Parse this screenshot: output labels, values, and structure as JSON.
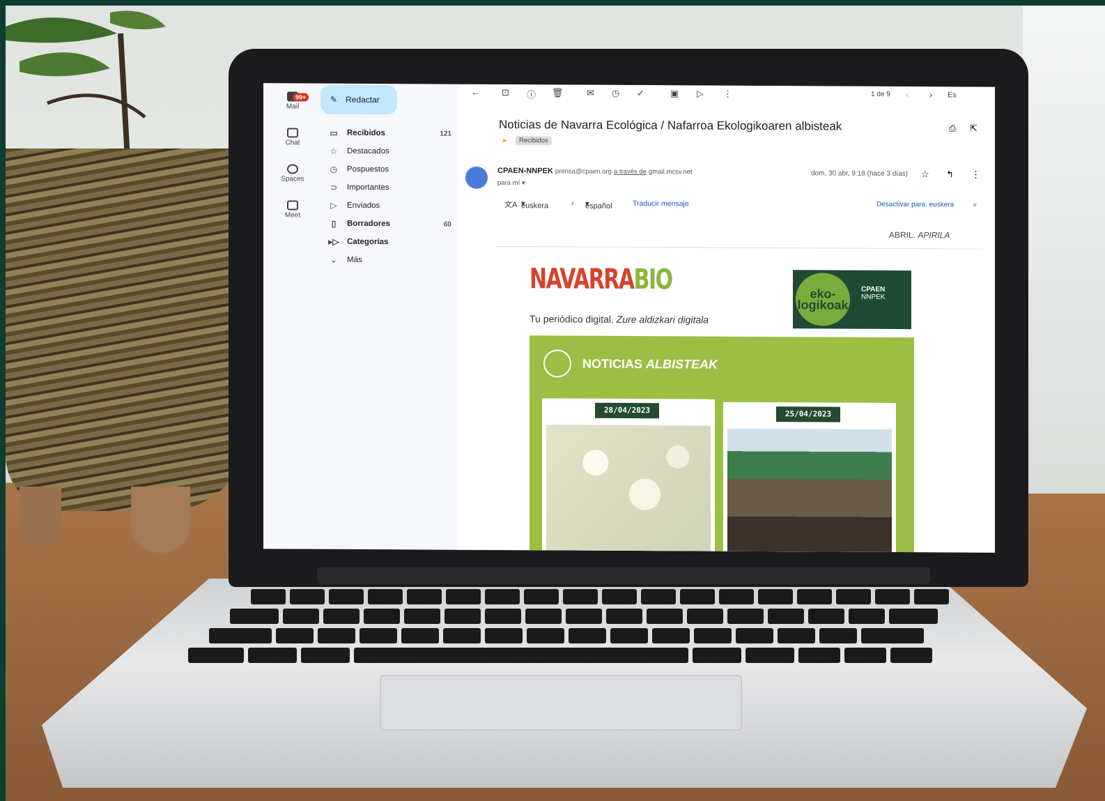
{
  "rail": {
    "mail_label": "Mail",
    "mail_badge": "99+",
    "chat_label": "Chat",
    "spaces_label": "Spaces",
    "meet_label": "Meet"
  },
  "compose": {
    "label": "Redactar"
  },
  "nav": {
    "items": [
      {
        "label": "Recibidos",
        "count": "121",
        "icon": "inbox-icon"
      },
      {
        "label": "Destacados",
        "count": "",
        "icon": "star-icon"
      },
      {
        "label": "Pospuestos",
        "count": "",
        "icon": "clock-icon"
      },
      {
        "label": "Importantes",
        "count": "",
        "icon": "important-icon"
      },
      {
        "label": "Enviados",
        "count": "",
        "icon": "send-icon"
      },
      {
        "label": "Borradores",
        "count": "60",
        "icon": "draft-icon"
      },
      {
        "label": "Categorías",
        "count": "",
        "icon": "label-icon"
      },
      {
        "label": "Más",
        "count": "",
        "icon": "chevron-down-icon"
      }
    ]
  },
  "toolbar": {
    "pager": "1 de 9",
    "lang": "Es"
  },
  "email": {
    "subject": "Noticias de Navarra Ecológica / Nafarroa Ekologikoaren albisteak",
    "label_chip": "Recibidos",
    "sender_name": "CPAEN-NNPEK",
    "sender_addr": "prensa@cpaen.org",
    "via_text": "a través de",
    "via_domain": "gmail.mcsv.net",
    "to_me": "para mí",
    "date": "dom, 30 abr, 9:18 (hace 3 días)",
    "translate": {
      "from": "euskera",
      "to": "español",
      "action": "Traducir mensaje",
      "disable": "Desactivar para: euskera"
    }
  },
  "newsletter": {
    "month": "ABRIL",
    "month_eu": "APIRILA",
    "logo_main": "NAVARRA",
    "logo_accent": "BIO",
    "tagline": "Tu periódico digital.",
    "tagline_eu": "Zure aldizkari digitala",
    "eko_badge": "eko-logikoak",
    "cpaen": "CPAEN",
    "nnpek": "NNPEK",
    "section_title": "NOTICIAS",
    "section_title_eu": "ALBISTEAK",
    "cards": [
      {
        "date": "28/04/2023"
      },
      {
        "date": "25/04/2023"
      }
    ]
  }
}
